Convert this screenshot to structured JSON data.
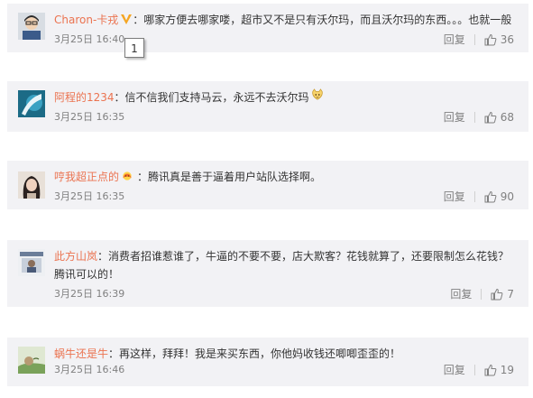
{
  "comments": [
    {
      "user": "Charon-卡戎",
      "text": "：哪家方便去哪家喽，超市又不是只有沃尔玛，而且沃尔玛的东西。。。也就一般",
      "time": "3月25日 16:40",
      "reply": "回复",
      "likes": "36",
      "badge": "v-verified-icon"
    },
    {
      "user": "阿程的1234",
      "text": "：信不信我们支持马云，永远不去沃尔玛",
      "time": "3月25日 16:35",
      "reply": "回复",
      "likes": "68",
      "emoji": "cat-emoji-icon"
    },
    {
      "user": "哼我超正点的",
      "text": "：腾讯真是善于逼着用户站队选择啊。",
      "time": "3月25日 16:35",
      "reply": "回复",
      "likes": "90",
      "badge": "flame-badge-icon"
    },
    {
      "user": "此方山岚",
      "text": "：消费者招谁惹谁了，牛逼的不要不要，店大欺客？花钱就算了，还要限制怎么花钱？腾讯可以的！",
      "time": "3月25日 16:39",
      "reply": "回复",
      "likes": "7"
    },
    {
      "user": "蜗牛还是牛",
      "text": "：再这样，拜拜！我是来买东西，你他妈收钱还唧唧歪歪的！",
      "time": "3月25日 16:46",
      "reply": "回复",
      "likes": "19"
    }
  ],
  "marker": "1",
  "colors": {
    "username": "#eb7350",
    "text": "#333333",
    "meta": "#808080",
    "card_bg": "#f2f2f5"
  }
}
